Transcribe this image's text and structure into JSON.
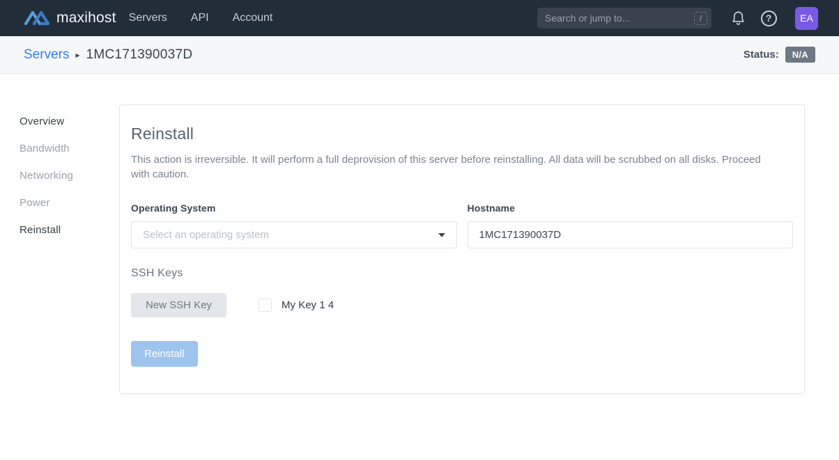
{
  "navbar": {
    "brand": "maxihost",
    "items": [
      {
        "label": "Servers"
      },
      {
        "label": "API"
      },
      {
        "label": "Account"
      }
    ],
    "search": {
      "placeholder": "Search or jump to...",
      "shortcut": "/"
    },
    "help": "?",
    "avatar_initials": "EA"
  },
  "breadcrumb": {
    "root": "Servers",
    "separator": "▸",
    "current": "1MC171390037D",
    "status_label": "Status:",
    "status_value": "N/A"
  },
  "sidebar": {
    "items": [
      {
        "label": "Overview"
      },
      {
        "label": "Bandwidth"
      },
      {
        "label": "Networking"
      },
      {
        "label": "Power"
      },
      {
        "label": "Reinstall"
      }
    ]
  },
  "main": {
    "title": "Reinstall",
    "description": "This action is irreversible. It will perform a full deprovision of this server before reinstalling. All data will be scrubbed on all disks. Proceed with caution.",
    "os_label": "Operating System",
    "os_placeholder": "Select an operating system",
    "hostname_label": "Hostname",
    "hostname_value": "1MC171390037D",
    "ssh_section_label": "SSH Keys",
    "new_ssh_key_button": "New SSH Key",
    "ssh_key_checkbox_label": "My Key 1 4",
    "ssh_key_checked": false,
    "reinstall_button": "Reinstall"
  },
  "colors": {
    "navbar_bg": "#222d3a",
    "accent_blue": "#2e7ff0",
    "logo_blue": "#4e8fd5",
    "avatar_purple": "#7a5ae4",
    "status_badge_bg": "#6e7783",
    "disabled_button_bg": "#9dc3ef"
  }
}
